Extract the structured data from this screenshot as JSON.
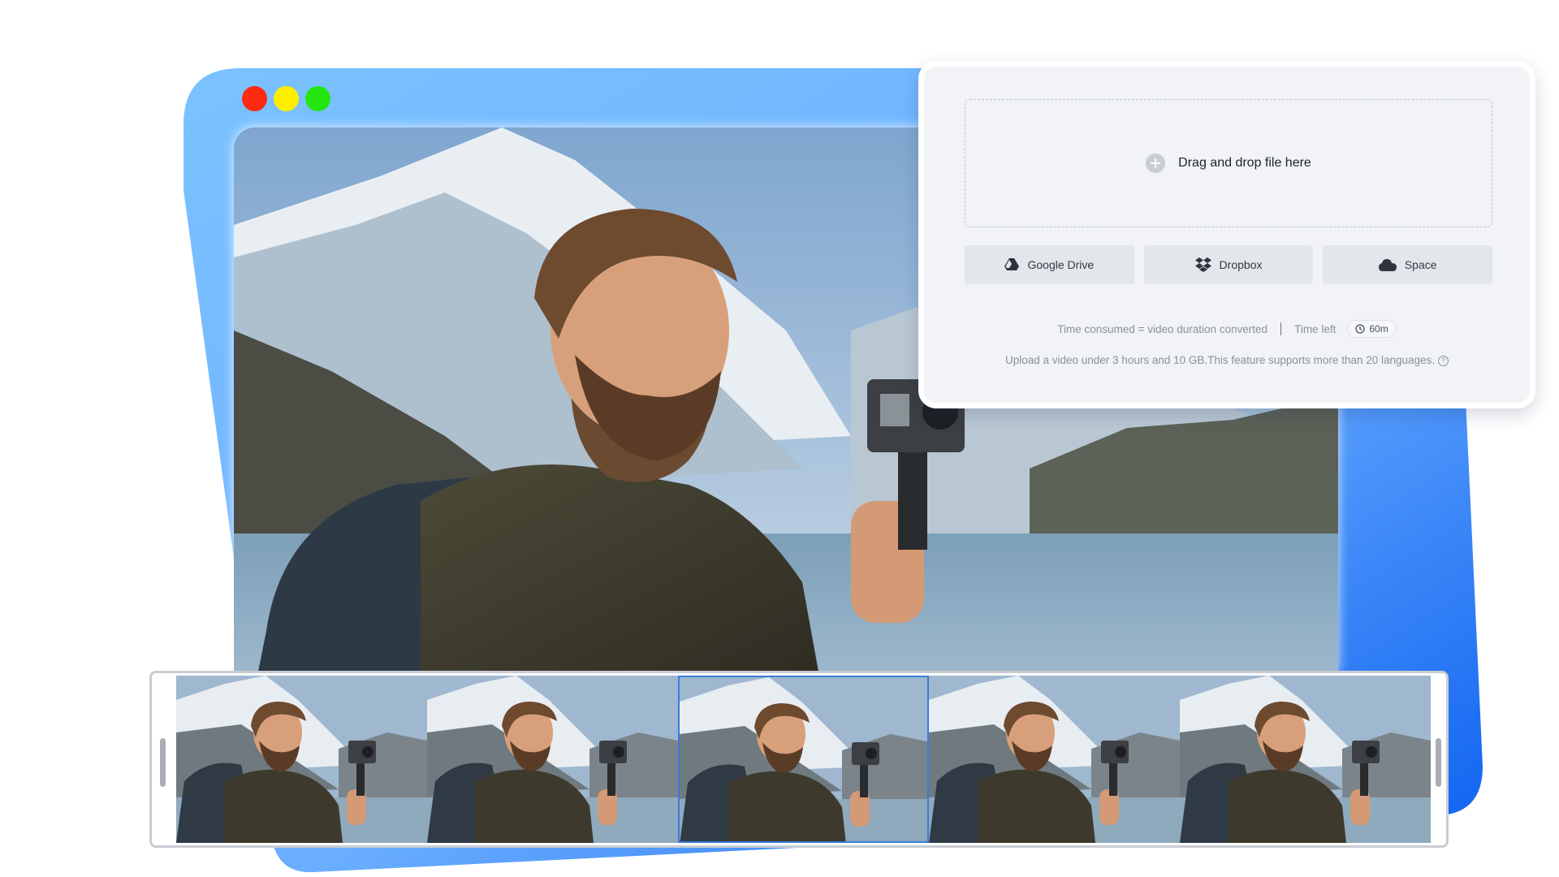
{
  "window": {
    "controls": [
      {
        "name": "close",
        "color": "#ff2a12"
      },
      {
        "name": "minimize",
        "color": "#ffee00"
      },
      {
        "name": "maximize",
        "color": "#23e60e"
      }
    ]
  },
  "upload": {
    "drop_label": "Drag and drop file here",
    "sources": [
      {
        "label": "Google Drive",
        "icon": "google-drive-icon"
      },
      {
        "label": "Dropbox",
        "icon": "dropbox-icon"
      },
      {
        "label": "Space",
        "icon": "cloud-icon"
      }
    ],
    "time_consumed": "Time consumed = video duration converted",
    "time_left_label": "Time left",
    "time_left_value": "60m",
    "note": "Upload a video under 3 hours and 10 GB.This feature supports more than 20 languages."
  },
  "filmstrip": {
    "frame_count": 5,
    "selected_index": 2
  },
  "colors": {
    "accent": "#1a6ff0",
    "card_light": "#7cc0ff",
    "panel_bg": "#f1f3f6"
  }
}
